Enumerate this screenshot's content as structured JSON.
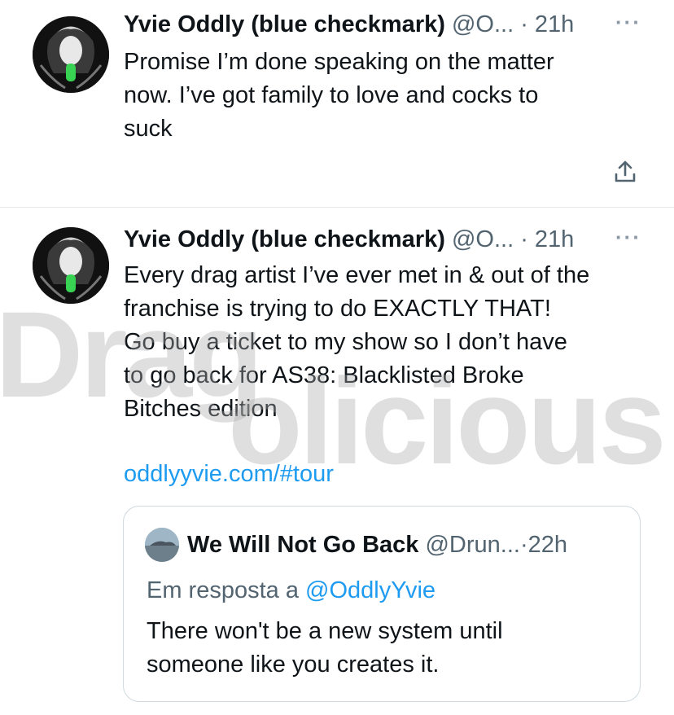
{
  "tweets": [
    {
      "author_name": "Yvie Oddly (blue checkmark)",
      "handle": "@O...",
      "separator": "·",
      "time": "21h",
      "more": "···",
      "text": "Promise I’m done speaking on the matter\nnow. I’ve got family to love and cocks to\nsuck",
      "share_icon": "share-icon"
    },
    {
      "author_name": "Yvie Oddly (blue checkmark)",
      "handle": "@O...",
      "separator": "·",
      "time": "21h",
      "more": "···",
      "text": "Every drag artist I’ve ever met in & out of the\nfranchise is trying to do EXACTLY THAT!\nGo buy a ticket to my show so I don’t have\nto go back for AS38: Blacklisted Broke\nBitches edition",
      "link": "oddlyyvie.com/#tour",
      "quote": {
        "author_name": "We Will Not Go Back",
        "handle": "@Drun...",
        "separator": "·",
        "time": "22h",
        "reply_prefix": "Em resposta a",
        "reply_to": "@OddlyYvie",
        "text": "There won't be a new system until\nsomeone like you creates it."
      }
    }
  ],
  "watermark": {
    "line1": "Drag",
    "line2": "olicious"
  },
  "colors": {
    "link": "#1d9bf0",
    "secondary_text": "#536471",
    "primary_text": "#0f1419",
    "border": "#cfd9de"
  }
}
